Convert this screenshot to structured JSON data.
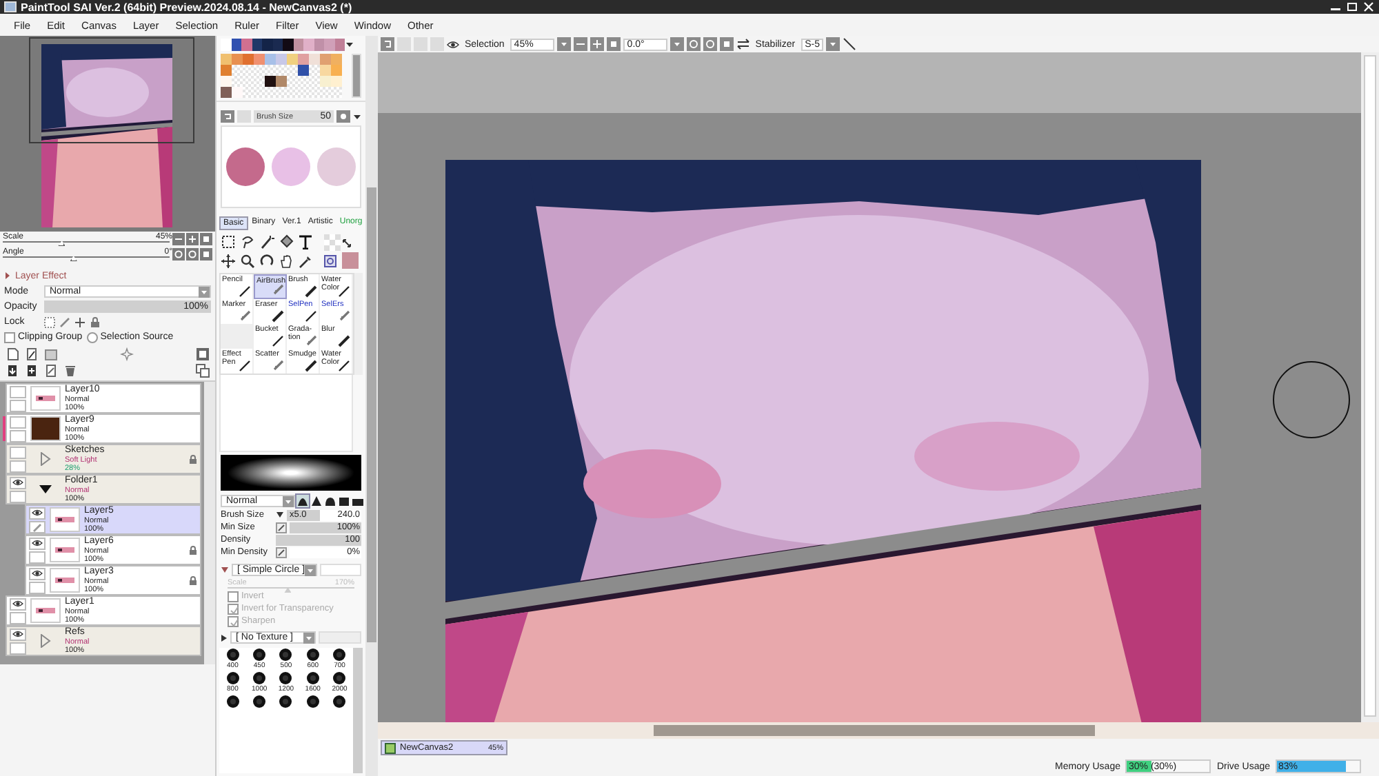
{
  "window": {
    "title": "PaintTool SAI Ver.2 (64bit) Preview.2024.08.14 - NewCanvas2 (*)"
  },
  "menu": [
    "File",
    "Edit",
    "Canvas",
    "Layer",
    "Selection",
    "Ruler",
    "Filter",
    "View",
    "Window",
    "Other"
  ],
  "navigator": {
    "scale": {
      "label": "Scale",
      "value": "45%",
      "level": 0.35
    },
    "angle": {
      "label": "Angle",
      "value": "0°",
      "level": 0.42
    }
  },
  "layer_panel": {
    "effect_label": "Layer Effect",
    "mode_label": "Mode",
    "mode": "Normal",
    "opacity": {
      "label": "Opacity",
      "value": "100%",
      "level": 1
    },
    "lock_label": "Lock",
    "clipping_group": {
      "label": "Clipping Group",
      "checked": false
    },
    "selection_source": {
      "label": "Selection Source",
      "selected": false
    },
    "layers": [
      {
        "name": "Layer10",
        "mode": "Normal",
        "opacity": "100%",
        "kind": "layer",
        "visible": false,
        "locked": false,
        "selected": false,
        "flagged": false
      },
      {
        "name": "Layer9",
        "mode": "Normal",
        "opacity": "100%",
        "kind": "layer",
        "visible": false,
        "locked": false,
        "selected": false,
        "flagged": true,
        "color": "#4a2410"
      },
      {
        "name": "Sketches",
        "mode": "Soft Light",
        "opacity": "28%",
        "kind": "folder",
        "expanded": false,
        "visible": false,
        "locked": true,
        "selected": false,
        "flagged": false,
        "opacity_highlight": true
      },
      {
        "name": "Folder1",
        "mode": "Normal",
        "opacity": "100%",
        "kind": "folder",
        "expanded": true,
        "visible": true,
        "locked": false,
        "selected": false,
        "flagged": false,
        "children": [
          {
            "name": "Layer5",
            "mode": "Normal",
            "opacity": "100%",
            "kind": "layer",
            "visible": true,
            "locked": false,
            "selected": true,
            "editing": true,
            "flagged": false
          },
          {
            "name": "Layer6",
            "mode": "Normal",
            "opacity": "100%",
            "kind": "layer",
            "visible": true,
            "locked": true,
            "selected": false,
            "flagged": false
          },
          {
            "name": "Layer3",
            "mode": "Normal",
            "opacity": "100%",
            "kind": "layer",
            "visible": true,
            "locked": true,
            "selected": false,
            "flagged": false
          }
        ]
      },
      {
        "name": "Layer1",
        "mode": "Normal",
        "opacity": "100%",
        "kind": "layer",
        "visible": true,
        "locked": false,
        "selected": false,
        "flagged": false
      },
      {
        "name": "Refs",
        "mode": "Normal",
        "opacity": "100%",
        "kind": "folder",
        "expanded": false,
        "visible": true,
        "locked": false,
        "selected": false,
        "flagged": false
      }
    ]
  },
  "palette": {
    "top": [
      {
        "color": "#ffffff"
      },
      {
        "color": "#3050b0"
      },
      {
        "color": "#d07090"
      },
      {
        "color": "#203868"
      },
      {
        "color": "#142448"
      },
      {
        "color": "#1a2a50"
      },
      {
        "color": "#120a14"
      },
      {
        "color": "#c090a0"
      },
      {
        "color": "#e0b0c8"
      },
      {
        "color": "#c090a8"
      },
      {
        "color": "#d0a0b8"
      },
      {
        "color": "#c08098"
      }
    ],
    "grid": [
      {
        "color": "#f0c070"
      },
      {
        "color": "#e89050"
      },
      {
        "color": "#e07030"
      },
      {
        "color": "#f09070"
      },
      {
        "color": "#a8c0e8"
      },
      {
        "color": "#c8c8e8"
      },
      {
        "color": "#f0d080"
      },
      {
        "color": "#e0a0a0"
      },
      {
        "color": "#f0e0d8"
      },
      {
        "color": "#e0a070"
      },
      {
        "color": "#f0b060"
      },
      {
        "color": "#e08030"
      },
      {
        "kind": "empty"
      },
      {
        "kind": "empty"
      },
      {
        "kind": "empty"
      },
      {
        "kind": "empty"
      },
      {
        "kind": "empty"
      },
      {
        "kind": "empty"
      },
      {
        "color": "#3050a8"
      },
      {
        "kind": "empty"
      },
      {
        "color": "#f8d8a0"
      },
      {
        "color": "#f8b050"
      },
      {
        "color": "#fff8f0"
      },
      {
        "kind": "empty"
      },
      {
        "kind": "empty"
      },
      {
        "kind": "empty"
      },
      {
        "color": "#201010"
      },
      {
        "color": "#b08868"
      },
      {
        "kind": "empty"
      },
      {
        "kind": "empty"
      },
      {
        "kind": "empty"
      },
      {
        "color": "#f8f0d0"
      },
      {
        "color": "#fff0d0"
      },
      {
        "color": "#806058"
      },
      {
        "color": "#fff8f8"
      },
      {
        "kind": "empty"
      },
      {
        "kind": "empty"
      },
      {
        "kind": "empty"
      },
      {
        "kind": "empty"
      },
      {
        "kind": "empty"
      },
      {
        "kind": "empty"
      },
      {
        "kind": "empty"
      },
      {
        "kind": "empty"
      },
      {
        "kind": "empty"
      }
    ]
  },
  "brush_size_bar": {
    "label": "Brush Size",
    "value": "50"
  },
  "color_previews": [
    {
      "color": "#c46a8c"
    },
    {
      "color": "#e8c0e6"
    },
    {
      "color": "#e4ccdc"
    }
  ],
  "tool_tabs": [
    {
      "label": "Basic",
      "selected": true,
      "kind": "plain"
    },
    {
      "label": "Binary",
      "selected": false,
      "kind": "plain"
    },
    {
      "label": "Ver.1",
      "selected": false,
      "kind": "plain"
    },
    {
      "label": "Artistic",
      "selected": false,
      "kind": "plain"
    },
    {
      "label": "Unorg",
      "selected": false,
      "kind": "extra"
    }
  ],
  "current_color": {
    "color": "#c8909a"
  },
  "tools": [
    {
      "label": "Pencil",
      "kind": "paint",
      "selected": false
    },
    {
      "label": "AirBrush",
      "kind": "paint",
      "selected": true
    },
    {
      "label": "Brush",
      "kind": "paint",
      "selected": false
    },
    {
      "label": "Water Color",
      "kind": "paint",
      "selected": false
    },
    {
      "label": "Marker",
      "kind": "paint",
      "selected": false
    },
    {
      "label": "Eraser",
      "kind": "paint",
      "selected": false
    },
    {
      "label": "SelPen",
      "kind": "selection",
      "selected": false
    },
    {
      "label": "SelErs",
      "kind": "selection",
      "selected": false
    },
    {
      "kind": "empty"
    },
    {
      "label": "Bucket",
      "kind": "paint",
      "selected": false
    },
    {
      "label": "Grada-tion",
      "kind": "paint",
      "selected": false
    },
    {
      "label": "Blur",
      "kind": "paint",
      "selected": false
    },
    {
      "label": "Effect Pen",
      "kind": "paint",
      "selected": false
    },
    {
      "label": "Scatter",
      "kind": "paint",
      "selected": false
    },
    {
      "label": "Smudge",
      "kind": "paint",
      "selected": false
    },
    {
      "label": "Water Color",
      "kind": "paint",
      "selected": false
    }
  ],
  "brush": {
    "blend": "Normal",
    "tips": [
      {
        "selected": true
      },
      {
        "selected": false
      },
      {
        "selected": false
      },
      {
        "selected": false
      },
      {
        "selected": false
      }
    ],
    "size": {
      "label": "Brush Size",
      "multiplier": "x5.0",
      "value": "240.0",
      "level": 0.45
    },
    "min_size": {
      "label": "Min Size",
      "value": "100%",
      "level": 1
    },
    "density": {
      "label": "Density",
      "value": "100",
      "level": 1
    },
    "min_density": {
      "label": "Min Density",
      "value": "0%",
      "level": 0
    },
    "shape": {
      "label": "[ Simple Circle ]",
      "expanded": true,
      "scale": {
        "label": "Scale",
        "value": "170%",
        "level": 0.47
      },
      "options": [
        {
          "label": "Invert",
          "checked": false
        },
        {
          "label": "Invert for Transparency",
          "checked": true
        },
        {
          "label": "Sharpen",
          "checked": true
        }
      ]
    },
    "texture": {
      "label": "[ No Texture ]",
      "expanded": false
    },
    "presets": [
      {
        "kind": "sized",
        "label": "400"
      },
      {
        "kind": "sized",
        "label": "450"
      },
      {
        "kind": "sized",
        "label": "500"
      },
      {
        "kind": "sized",
        "label": "600"
      },
      {
        "kind": "sized",
        "label": "700"
      },
      {
        "kind": "sized",
        "label": "800"
      },
      {
        "kind": "sized",
        "label": "1000"
      },
      {
        "kind": "sized",
        "label": "1200"
      },
      {
        "kind": "sized",
        "label": "1600"
      },
      {
        "kind": "sized",
        "label": "2000"
      },
      {
        "kind": "cut"
      },
      {
        "kind": "cut"
      },
      {
        "kind": "cut"
      },
      {
        "kind": "cut"
      },
      {
        "kind": "cut"
      }
    ]
  },
  "toolbar": {
    "selection_label": "Selection",
    "zoom": "45%",
    "angle": "0.0°",
    "stabilizer_label": "Stabilizer",
    "stabilizer": "S-5"
  },
  "canvas_tabs": [
    {
      "label": "NewCanvas2",
      "zoom": "45%",
      "selected": true
    }
  ],
  "status_bar": {
    "memory": {
      "label": "Memory Usage",
      "value": "30% (30%)",
      "level": 0.3
    },
    "drive": {
      "label": "Drive Usage",
      "value": "83%",
      "level": 0.83
    }
  }
}
